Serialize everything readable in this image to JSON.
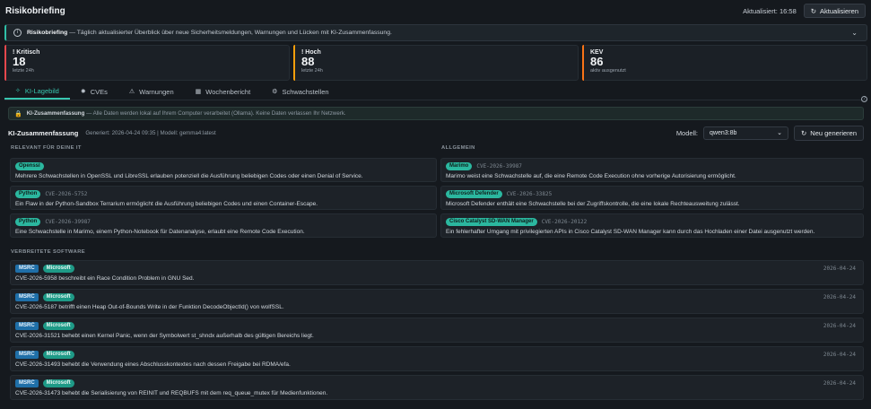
{
  "header": {
    "title": "Risikobriefing",
    "updated_label": "Aktualisiert: 16:58",
    "refresh_label": "Aktualisieren"
  },
  "banner": {
    "bold": "Risikobriefing",
    "text": " — Täglich aktualisierter Überblick über neue Sicherheitsmeldungen, Warnungen und Lücken mit KI-Zusammenfassung."
  },
  "stats": [
    {
      "label": "Kritisch",
      "value": "18",
      "sub": "letzte 24h"
    },
    {
      "label": "Hoch",
      "value": "88",
      "sub": "letzte 24h"
    },
    {
      "label": "KEV",
      "value": "86",
      "sub": "aktiv ausgenutzt"
    }
  ],
  "tabs": [
    {
      "label": "KI-Lagebild",
      "icon": "sparkle-icon"
    },
    {
      "label": "CVEs",
      "icon": "bug-icon"
    },
    {
      "label": "Warnungen",
      "icon": "warning-icon"
    },
    {
      "label": "Wochenbericht",
      "icon": "calendar-icon"
    },
    {
      "label": "Schwachstellen",
      "icon": "gear-icon"
    }
  ],
  "privacy": {
    "bold": "KI-Zusammenfassung",
    "text": " — Alle Daten werden lokal auf Ihrem Computer verarbeitet (Ollama). Keine Daten verlassen Ihr Netzwerk."
  },
  "summary": {
    "title": "KI-Zusammenfassung",
    "meta": "Generiert: 2026-04-24 09:35  |  Modell: gemma4:latest",
    "model_label": "Modell:",
    "model_value": "qwen3:8b",
    "regen_label": "Neu generieren"
  },
  "sections": {
    "relevant": "RELEVANT FÜR DEINE IT",
    "general": "ALLGEMEIN",
    "software": "VERBREITETE SOFTWARE"
  },
  "relevant": [
    {
      "tag": "Openssl",
      "cve": "",
      "text": "Mehrere Schwachstellen in OpenSSL und LibreSSL erlauben potenziell die Ausführung beliebigen Codes oder einen Denial of Service."
    },
    {
      "tag": "Python",
      "cve": "CVE-2026-5752",
      "text": "Ein Flaw in der Python-Sandbox Terrarium ermöglicht die Ausführung beliebigen Codes und einen Container-Escape."
    },
    {
      "tag": "Python",
      "cve": "CVE-2026-39987",
      "text": "Eine Schwachstelle in Marimo, einem Python-Notebook für Datenanalyse, erlaubt eine Remote Code Execution."
    }
  ],
  "general": [
    {
      "tag": "Marimo",
      "cve": "CVE-2026-39987",
      "text": "Marimo weist eine Schwachstelle auf, die eine Remote Code Execution ohne vorherige Autorisierung ermöglicht."
    },
    {
      "tag": "Microsoft Defender",
      "cve": "CVE-2026-33825",
      "text": "Microsoft Defender enthält eine Schwachstelle bei der Zugriffskontrolle, die eine lokale Rechteausweitung zulässt."
    },
    {
      "tag": "Cisco Catalyst SD-WAN Manager",
      "cve": "CVE-2026-20122",
      "text": "Ein fehlerhafter Umgang mit privilegierten APIs in Cisco Catalyst SD-WAN Manager kann durch das Hochladen einer Datei ausgenutzt werden."
    }
  ],
  "software": [
    {
      "tag1": "MSRC",
      "tag2": "Microsoft",
      "text": "CVE-2026-5958 beschreibt ein Race Condition Problem in GNU Sed.",
      "date": "2026-04-24"
    },
    {
      "tag1": "MSRC",
      "tag2": "Microsoft",
      "text": "CVE-2026-5187 betrifft einen Heap Out-of-Bounds Write in der Funktion DecodeObjectId() von wolfSSL.",
      "date": "2026-04-24"
    },
    {
      "tag1": "MSRC",
      "tag2": "Microsoft",
      "text": "CVE-2026-31521 behebt einen Kernel Panic, wenn der Symbolwert st_shndx außerhalb des gültigen Bereichs liegt.",
      "date": "2026-04-24"
    },
    {
      "tag1": "MSRC",
      "tag2": "Microsoft",
      "text": "CVE-2026-31493 behebt die Verwendung eines Abschlusskontextes nach dessen Freigabe bei RDMA/efa.",
      "date": "2026-04-24"
    },
    {
      "tag1": "MSRC",
      "tag2": "Microsoft",
      "text": "CVE-2026-31473 behebt die Serialisierung von REINIT und REQBUFS mit dem req_queue_mutex für Medienfunktionen.",
      "date": "2026-04-24"
    }
  ],
  "colors": {
    "accent": "#38c7b0",
    "critical": "#e5484d",
    "high": "#f59e0b",
    "kev": "#f97316",
    "background": "#15191e"
  }
}
